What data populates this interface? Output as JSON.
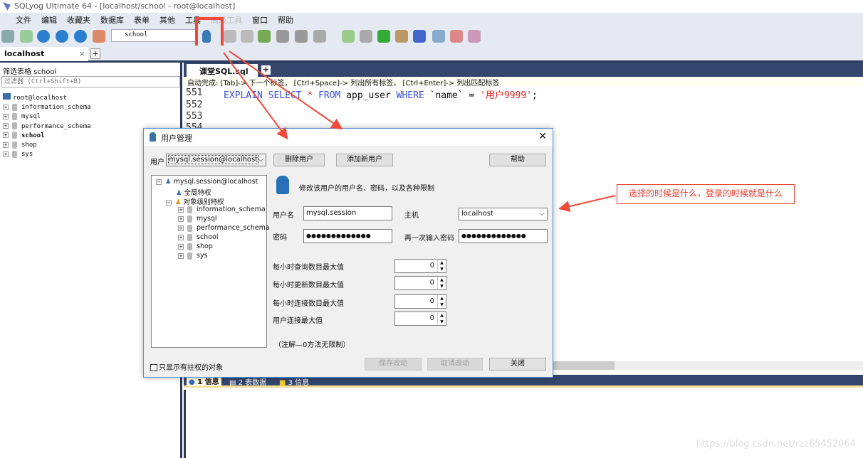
{
  "window": {
    "title": "SQLyog Ultimate 64 - [localhost/school - root@localhost]"
  },
  "menu": [
    "文件",
    "编辑",
    "收藏夹",
    "数据库",
    "表单",
    "其他",
    "工具",
    "高级工具",
    "窗口",
    "帮助"
  ],
  "toolbar": {
    "database": "school"
  },
  "connection_tab": {
    "label": "localhost",
    "close": "×",
    "add": "+"
  },
  "left_panel": {
    "filter_label": "筛选表格 school",
    "filter_placeholder": "过滤器 (Ctrl+Shift+B)",
    "root": "root@localhost",
    "databases": [
      "information_schema",
      "mysql",
      "performance_schema",
      "school",
      "shop",
      "sys"
    ],
    "active_db": "school"
  },
  "editor": {
    "tab": "课堂SQL.sql",
    "add": "+",
    "hint": "自动完成: [Tab]-> 下一个标签， [Ctrl+Space]-> 列出所有标签， [Ctrl+Enter]-> 列出匹配标签",
    "lines": [
      {
        "n": "551",
        "kw1": "EXPLAIN SELECT",
        "star": " * ",
        "kw2": "FROM",
        "t1": " app_user ",
        "kw3": "WHERE",
        "t2": " `name` = ",
        "str": "'用户9999'",
        "end": ";"
      },
      {
        "n": "552"
      },
      {
        "n": "553"
      },
      {
        "n": "554"
      }
    ]
  },
  "results_tabs": [
    "1 信息",
    "2 表数据",
    "3 信息"
  ],
  "dialog": {
    "title": "用户管理",
    "close": "✕",
    "user_label": "用户",
    "user_value": "mysql.session@localhost",
    "delete_btn": "删除用户",
    "add_btn": "添加新用户",
    "help_btn": "帮助",
    "tree": {
      "user": "mysql.session@localhost",
      "global": "全局特权",
      "object": "对象级别特权",
      "dbs": [
        "information_schema",
        "mysql",
        "performance_schema",
        "school",
        "shop",
        "sys"
      ]
    },
    "description": "修改该用户的用户名、密码，以及各种限制",
    "username_label": "用户名",
    "username": "mysql.session",
    "host_label": "主机",
    "host": "localhost",
    "password_label": "密码",
    "password": "●●●●●●●●●●●●●",
    "password2_label": "再一次输入密码",
    "password2": "●●●●●●●●●●●●●",
    "limits": [
      {
        "label": "每小时查询数目最大值",
        "value": "0"
      },
      {
        "label": "每小时更新数目最大值",
        "value": "0"
      },
      {
        "label": "每小时连接数目最大值",
        "value": "0"
      },
      {
        "label": "用户连接最大值",
        "value": "0"
      }
    ],
    "note": "（注解—0方法无限制）",
    "checkbox": "只显示有拄权的对象",
    "save_btn": "保存改动",
    "cancel_btn": "取消改动",
    "close_btn": "关闭"
  },
  "annotation": "选择的时候是什么，登录的时候就是什么",
  "watermark": "https://blog.csdn.net/rzz65452064",
  "colors": {
    "accent_red": "#e53b2c",
    "navy": "#34466c"
  }
}
